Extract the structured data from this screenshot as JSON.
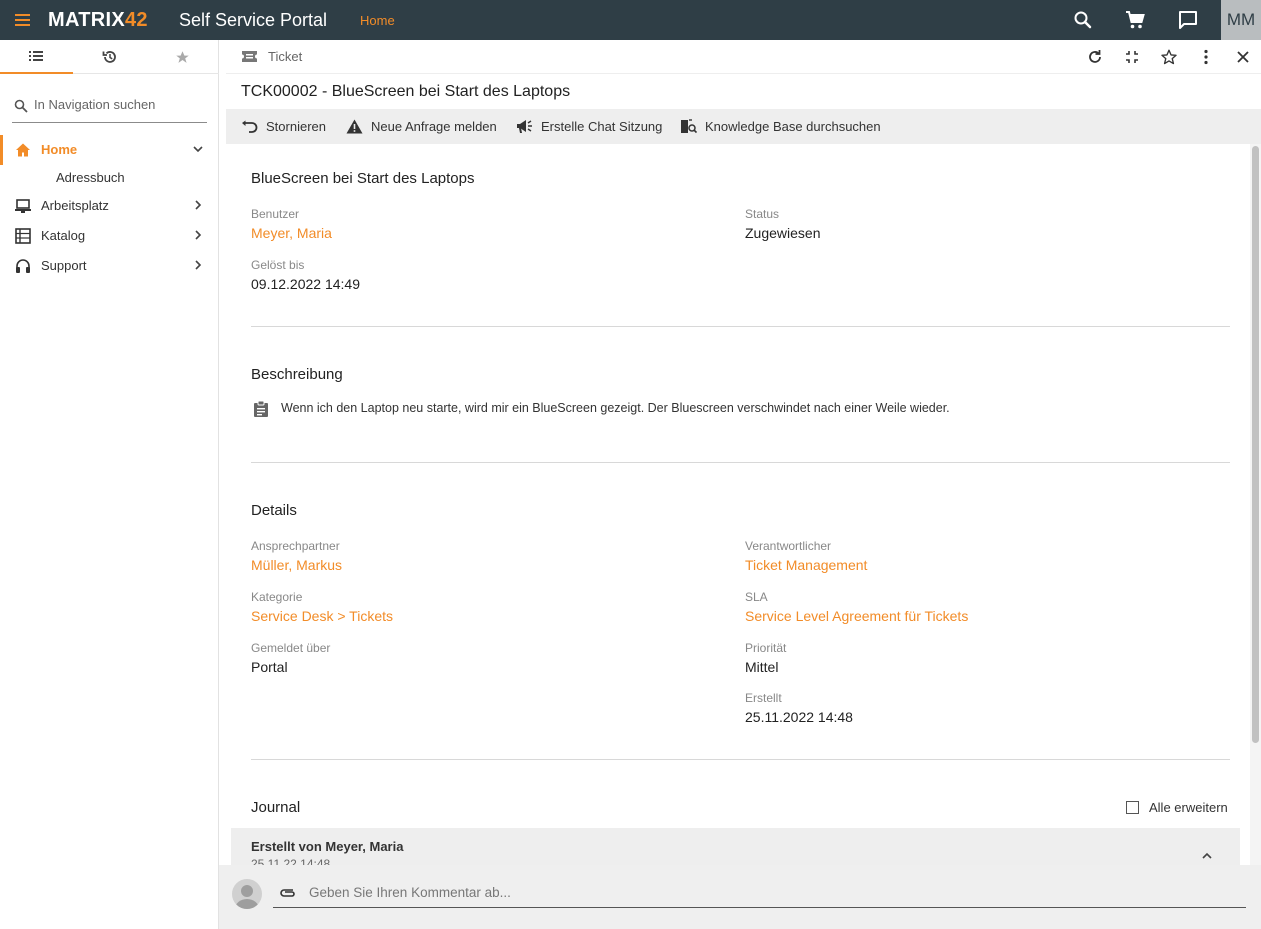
{
  "colors": {
    "accent": "#f28c28",
    "topbar": "#2f3e46"
  },
  "topbar": {
    "logo_main": "MATRIX",
    "logo_num": "42",
    "app_title": "Self Service Portal",
    "home_link": "Home",
    "avatar_initials": "MM",
    "icons": [
      "menu-icon",
      "search-icon",
      "cart-icon",
      "chat-icon"
    ]
  },
  "sidebar": {
    "tabs": [
      "list-icon",
      "history-icon",
      "star-icon"
    ],
    "search_placeholder": "In Navigation suchen",
    "items": [
      {
        "label": "Home",
        "icon": "home-icon",
        "active": true,
        "expanded": true
      },
      {
        "label": "Arbeitsplatz",
        "icon": "workstation-icon"
      },
      {
        "label": "Katalog",
        "icon": "catalog-icon"
      },
      {
        "label": "Support",
        "icon": "headset-icon"
      }
    ],
    "sub_items": [
      "Adressbuch"
    ]
  },
  "panel": {
    "breadcrumb": "Ticket",
    "title": "TCK00002 - BlueScreen bei Start des Laptops",
    "actions": [
      {
        "label": "Stornieren",
        "icon": "undo-icon"
      },
      {
        "label": "Neue Anfrage melden",
        "icon": "warning-icon"
      },
      {
        "label": "Erstelle Chat Sitzung",
        "icon": "megaphone-icon"
      },
      {
        "label": "Knowledge Base durchsuchen",
        "icon": "book-search-icon"
      }
    ]
  },
  "summary": {
    "heading": "BlueScreen bei Start des Laptops",
    "user_label": "Benutzer",
    "user_value": "Meyer, Maria",
    "status_label": "Status",
    "status_value": "Zugewiesen",
    "resolved_label": "Gelöst bis",
    "resolved_value": "09.12.2022 14:49"
  },
  "description": {
    "heading": "Beschreibung",
    "text": "Wenn ich den Laptop neu starte, wird mir ein BlueScreen gezeigt. Der Bluescreen verschwindet nach einer Weile wieder."
  },
  "details": {
    "heading": "Details",
    "contact_label": "Ansprechpartner",
    "contact_value": "Müller, Markus",
    "responsible_label": "Verantwortlicher",
    "responsible_value": "Ticket Management",
    "category_label": "Kategorie",
    "category_value": "Service Desk > Tickets",
    "sla_label": "SLA",
    "sla_value": "Service Level Agreement für Tickets",
    "reported_label": "Gemeldet über",
    "reported_value": "Portal",
    "priority_label": "Priorität",
    "priority_value": "Mittel",
    "created_label": "Erstellt",
    "created_value": "25.11.2022 14:48"
  },
  "journal": {
    "heading": "Journal",
    "expand_all_label": "Alle erweitern",
    "entry_title": "Erstellt von Meyer, Maria",
    "entry_date": "25.11.22 14:48"
  },
  "comment": {
    "placeholder": "Geben Sie Ihren Kommentar ab..."
  }
}
